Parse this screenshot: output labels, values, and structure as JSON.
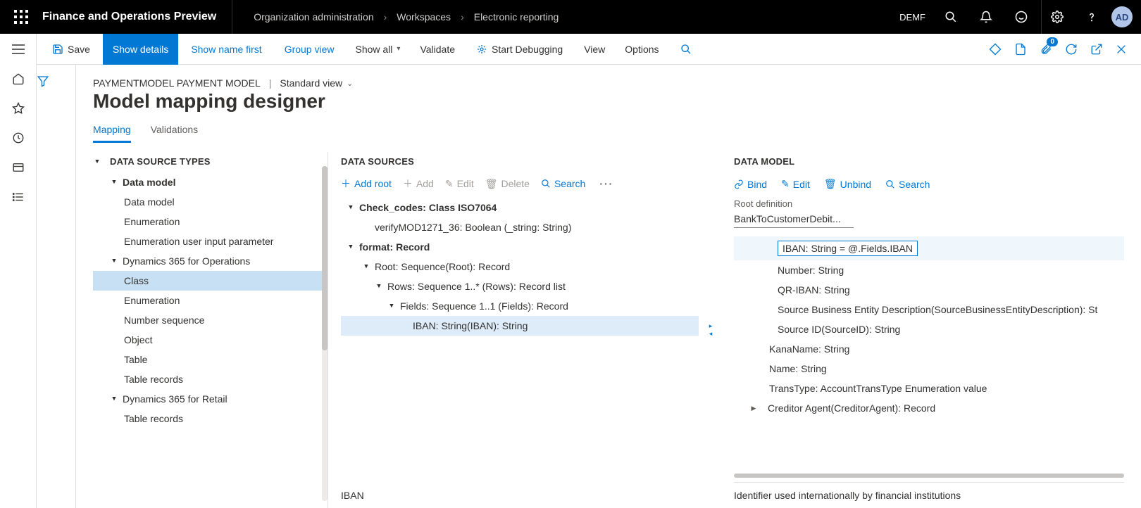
{
  "top": {
    "app_title": "Finance and Operations Preview",
    "breadcrumb": [
      "Organization administration",
      "Workspaces",
      "Electronic reporting"
    ],
    "company": "DEMF",
    "avatar": "AD"
  },
  "actions": {
    "save": "Save",
    "show_details": "Show details",
    "show_name_first": "Show name first",
    "group_view": "Group view",
    "show_all": "Show all",
    "validate": "Validate",
    "start_debugging": "Start Debugging",
    "view": "View",
    "options": "Options",
    "badge": "0"
  },
  "page_header": {
    "config": "PAYMENTMODEL PAYMENT MODEL",
    "view_mode": "Standard view",
    "title": "Model mapping designer",
    "tabs": {
      "mapping": "Mapping",
      "validations": "Validations"
    }
  },
  "ds_types": {
    "header": "DATA SOURCE TYPES",
    "items": [
      {
        "label": "Data model",
        "level": 1,
        "caret": "down",
        "bold": true
      },
      {
        "label": "Data model",
        "level": 2
      },
      {
        "label": "Enumeration",
        "level": 2
      },
      {
        "label": "Enumeration user input parameter",
        "level": 2
      },
      {
        "label": "Dynamics 365 for Operations",
        "level": 1,
        "caret": "down",
        "bold": false
      },
      {
        "label": "Class",
        "level": 2,
        "selected": true
      },
      {
        "label": "Enumeration",
        "level": 2
      },
      {
        "label": "Number sequence",
        "level": 2
      },
      {
        "label": "Object",
        "level": 2
      },
      {
        "label": "Table",
        "level": 2
      },
      {
        "label": "Table records",
        "level": 2
      },
      {
        "label": "Dynamics 365 for Retail",
        "level": 1,
        "caret": "down"
      },
      {
        "label": "Table records",
        "level": 2
      }
    ]
  },
  "ds": {
    "header": "DATA SOURCES",
    "add_root": "Add root",
    "add": "Add",
    "edit": "Edit",
    "delete": "Delete",
    "search": "Search",
    "tree": [
      {
        "label": "Check_codes: Class ISO7064",
        "indent": 0,
        "caret": "down",
        "bold": true
      },
      {
        "label": "verifyMOD1271_36: Boolean (_string: String)",
        "indent": 1
      },
      {
        "label": "format: Record",
        "indent": 0,
        "caret": "down",
        "bold": true
      },
      {
        "label": "Root: Sequence(Root): Record",
        "indent": 1,
        "caret": "down"
      },
      {
        "label": "Rows: Sequence 1..* (Rows): Record list",
        "indent": 2,
        "caret": "down"
      },
      {
        "label": "Fields: Sequence 1..1 (Fields): Record",
        "indent": 3,
        "caret": "down"
      },
      {
        "label": "IBAN: String(IBAN): String",
        "indent": 4,
        "selected": true
      }
    ],
    "footer": "IBAN"
  },
  "model": {
    "header": "DATA MODEL",
    "bind": "Bind",
    "edit": "Edit",
    "unbind": "Unbind",
    "search": "Search",
    "root_label": "Root definition",
    "root_value": "BankToCustomerDebit...",
    "tree": [
      {
        "label": "IBAN: String = @.Fields.IBAN",
        "lvl": 2,
        "selected": true,
        "boxed": true
      },
      {
        "label": "Number: String",
        "lvl": 2
      },
      {
        "label": "QR-IBAN: String",
        "lvl": 2
      },
      {
        "label": "Source Business Entity Description(SourceBusinessEntityDescription): St",
        "lvl": 2
      },
      {
        "label": "Source ID(SourceID): String",
        "lvl": 2
      },
      {
        "label": "KanaName: String",
        "lvl": 1
      },
      {
        "label": "Name: String",
        "lvl": 1
      },
      {
        "label": "TransType: AccountTransType Enumeration value",
        "lvl": 1
      },
      {
        "label": "Creditor Agent(CreditorAgent): Record",
        "lvl": 0,
        "caret": "right"
      }
    ],
    "footer": "Identifier used internationally by financial institutions"
  }
}
